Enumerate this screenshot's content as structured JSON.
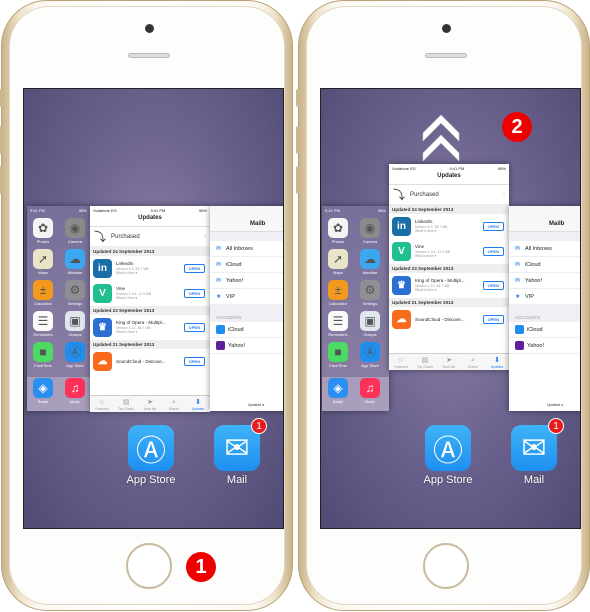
{
  "status_bar": {
    "carrier": "Vodafone EG",
    "time": "9:41 PM",
    "battery": "98%"
  },
  "home_screen": {
    "apps": [
      {
        "label": "Photos",
        "color": "#f4f4f4",
        "glyph": "✿"
      },
      {
        "label": "Camera",
        "color": "#8a8a8a",
        "glyph": "◉"
      },
      {
        "label": "Maps",
        "color": "#e9e3c7",
        "glyph": "➚"
      },
      {
        "label": "Weather",
        "color": "#3ba7f0",
        "glyph": "☁"
      },
      {
        "label": "Calculator",
        "color": "#f39a1e",
        "glyph": "±"
      },
      {
        "label": "Settings",
        "color": "#8e8e93",
        "glyph": "⚙"
      },
      {
        "label": "Reminders",
        "color": "#fafafa",
        "glyph": "☰"
      },
      {
        "label": "Groups",
        "color": "#dfe6ee",
        "glyph": "▣"
      },
      {
        "label": "FaceTime",
        "color": "#4cd964",
        "glyph": "■"
      },
      {
        "label": "App Store",
        "color": "#1e8ff0",
        "glyph": "Ⓐ"
      }
    ],
    "dock": [
      {
        "label": "Safari",
        "color": "#2a8ff0",
        "glyph": "◈"
      },
      {
        "label": "Music",
        "color": "#fc3158",
        "glyph": "♫"
      }
    ]
  },
  "app_store": {
    "title": "Updates",
    "purchased": "Purchased",
    "open_label": "OPEN",
    "sections": [
      {
        "header": "Updated 24 September 2013",
        "apps": [
          {
            "name": "LinkedIn",
            "version": "Version 6.2, 28.7 MB",
            "whatsnew": "What's New ▾",
            "color": "#1a6ea8",
            "glyph": "in"
          },
          {
            "name": "Vine",
            "version": "Version 1.3.4, 11.9 MB",
            "whatsnew": "What's New ▾",
            "color": "#1fbf8f",
            "glyph": "V"
          }
        ]
      },
      {
        "header": "Updated 23 September 2013",
        "apps": [
          {
            "name": "King of Opera - Multipl...",
            "version": "Version 1.12, 46.7 MB",
            "whatsnew": "What's New ▾",
            "color": "#2a6fd1",
            "glyph": "♛"
          }
        ]
      },
      {
        "header": "Updated 21 September 2013",
        "apps": [
          {
            "name": "SoundCloud - Discove...",
            "version": "",
            "whatsnew": "",
            "color": "#f86b1d",
            "glyph": "☁"
          }
        ]
      }
    ],
    "tabs": [
      {
        "label": "Featured",
        "glyph": "☆"
      },
      {
        "label": "Top Charts",
        "glyph": "▤"
      },
      {
        "label": "Near Me",
        "glyph": "➤"
      },
      {
        "label": "Search",
        "glyph": "⌕"
      },
      {
        "label": "Updates",
        "glyph": "⬇",
        "active": true
      }
    ]
  },
  "mail": {
    "title": "Mailb",
    "mailboxes": [
      {
        "label": "All Inboxes",
        "glyph": "✉"
      },
      {
        "label": "iCloud",
        "glyph": "✉"
      },
      {
        "label": "Yahoo!",
        "glyph": "✉"
      },
      {
        "label": "VIP",
        "glyph": "★"
      }
    ],
    "accounts_header": "ACCOUNTS",
    "accounts": [
      {
        "label": "iCloud",
        "color": "#1e8ff0"
      },
      {
        "label": "Yahoo!",
        "color": "#5f1f9a"
      }
    ],
    "footer": "Updated a"
  },
  "dock_apps": [
    {
      "label": "App Store",
      "color": "#1e8ff0",
      "glyph": "Ⓐ"
    },
    {
      "label": "Mail",
      "color": "#1e8ff0",
      "glyph": "✉",
      "badge": "1"
    }
  ],
  "steps": [
    "1",
    "2"
  ],
  "colors": {
    "badge_red": "#e81c1c",
    "ios_blue": "#1c7cf3",
    "wallpaper": "#6e6590"
  }
}
